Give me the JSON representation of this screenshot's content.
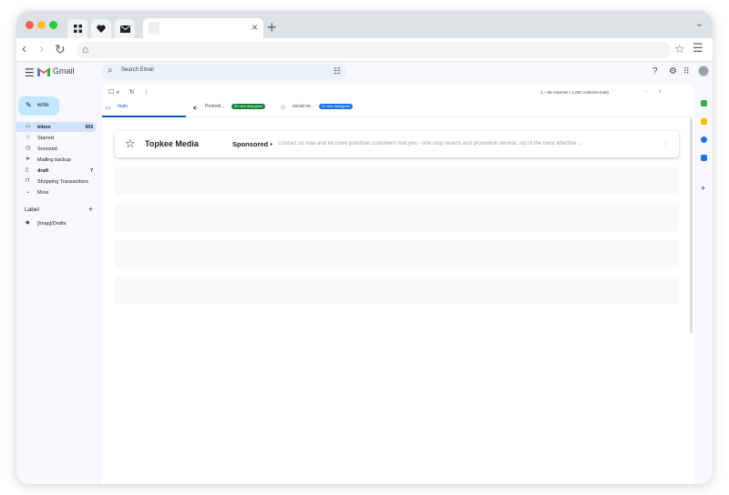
{
  "browser": {
    "tab_close": "×",
    "new_tab": "+"
  },
  "app": {
    "name": "Gmail",
    "search_placeholder": "Search Email",
    "compose_label": "write"
  },
  "sidebar": {
    "items": [
      {
        "label": "Inbox",
        "count": "659",
        "icon": "inbox-icon"
      },
      {
        "label": "Starred",
        "count": "",
        "icon": "star-icon"
      },
      {
        "label": "Snoozed",
        "count": "",
        "icon": "clock-icon"
      },
      {
        "label": "Mailing backup",
        "count": "",
        "icon": "send-icon"
      },
      {
        "label": "draft",
        "count": "7",
        "icon": "file-icon"
      },
      {
        "label": "Shopping Transactions",
        "count": "",
        "icon": "bag-icon"
      },
      {
        "label": "More",
        "count": "",
        "icon": "chevron-down-icon"
      }
    ],
    "labels_header": "Label",
    "labels": [
      {
        "label": "[Imap]/Drafts"
      }
    ]
  },
  "toolbar": {
    "pager_text": "1 – 50 columns ( 1,062 columns total)"
  },
  "tabs": [
    {
      "label": "main",
      "badge": ""
    },
    {
      "label": "Promoti...",
      "badge": "50 new dialogues",
      "badge_color": "#188038"
    },
    {
      "label": "social ne...",
      "badge": "11 new dialogues",
      "badge_color": "#1a73e8"
    }
  ],
  "messages": [
    {
      "sender": "Topkee Media",
      "tag": "Sponsored",
      "separator": "•",
      "snippet": "Contact us now and let more potential customers find you - one-stop search and promotion service, list of the most effective ..."
    }
  ],
  "colors": {
    "accent": "#0b57d0",
    "compose_bg": "#c2e7ff",
    "active_nav": "#d3e3fd"
  }
}
